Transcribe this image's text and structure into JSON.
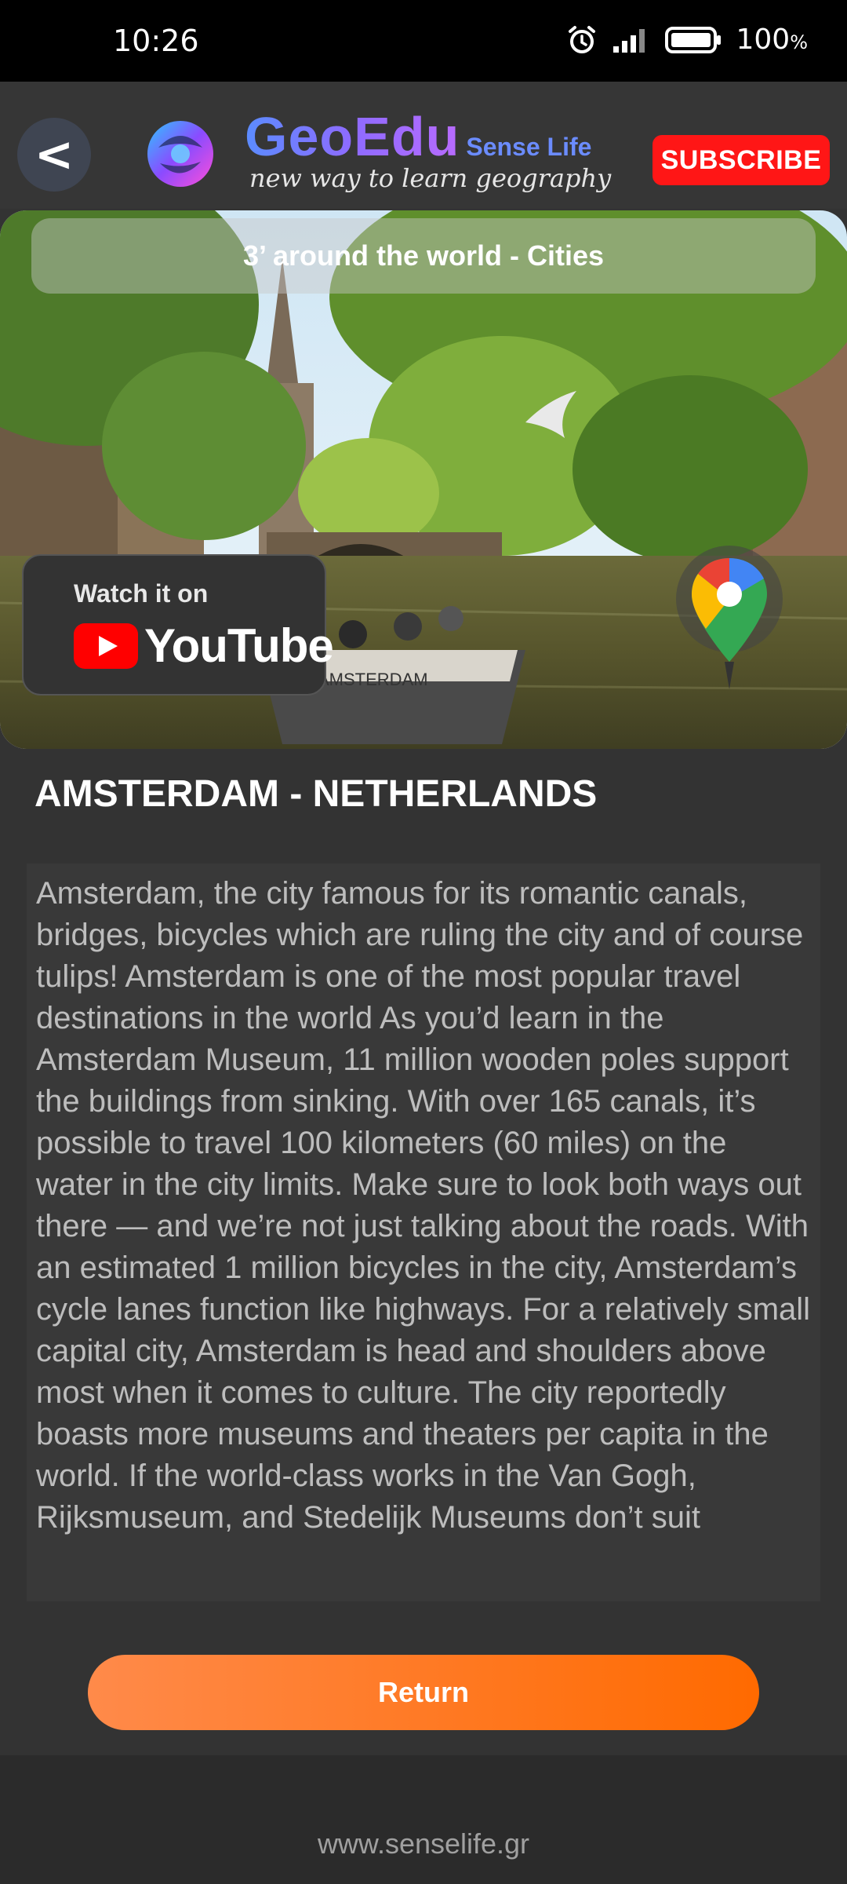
{
  "status_bar": {
    "time": "10:26",
    "battery_percent": "100",
    "battery_unit": "%",
    "icons": [
      "alarm-icon",
      "signal-icon",
      "battery-icon"
    ]
  },
  "header": {
    "back_label": "<",
    "brand_main": "GeoEdu",
    "brand_sub": "Sense Life",
    "tagline": "new way to learn geography",
    "subscribe_label": "SUBSCRIBE"
  },
  "hero": {
    "title": "3’ around the world - Cities",
    "youtube_watch": "Watch it on",
    "youtube_text": "YouTube",
    "boat_label": "AMSTERDAM"
  },
  "city": {
    "title": "AMSTERDAM - NETHERLANDS",
    "description": "Amsterdam, the city famous for its romantic canals, bridges, bicycles which are ruling the city and of course tulips! Amsterdam is one of the most popular travel destinations in the world   As you’d learn in the Amsterdam Museum, 11 million wooden poles support the buildings from sinking. With over 165 canals, it’s possible to travel 100 kilometers (60 miles) on the water in the city limits. Make sure to look both ways out there — and we’re not just talking about the roads. With an estimated 1 million bicycles in the city, Amsterdam’s cycle lanes function like highways. For a relatively small capital city, Amsterdam is head and shoulders above most when it comes to culture. The city reportedly boasts more museums and theaters per capita in the world. If the world-class works in the Van Gogh, Rijksmuseum, and Stedelijk Museums don’t suit"
  },
  "return_label": "Return",
  "footer": {
    "url": "www.senselife.gr"
  },
  "colors": {
    "background": "#333333",
    "subscribe": "#ff1616",
    "return_start": "#ff8a4a",
    "return_end": "#ff6a00"
  }
}
